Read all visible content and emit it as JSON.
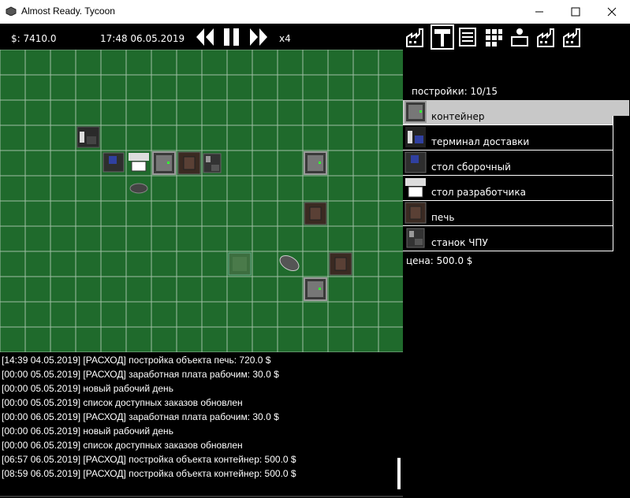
{
  "window": {
    "title": "Almost Ready. Tycoon"
  },
  "topbar": {
    "money": "$: 7410.0",
    "datetime": "17:48 06.05.2019",
    "speed": "x4"
  },
  "toolbar": {
    "icons": [
      "factory-icon",
      "hammer-icon",
      "orders-icon",
      "grid-icon",
      "worker-icon",
      "factory-icon",
      "factory-icon"
    ]
  },
  "side": {
    "buildings_count": "постройки: 10/15",
    "items": [
      {
        "label": "контейнер",
        "icon": "container-icon"
      },
      {
        "label": "терминал доставки",
        "icon": "terminal-icon"
      },
      {
        "label": "стол сборочный",
        "icon": "assembly-table-icon"
      },
      {
        "label": "стол разработчика",
        "icon": "developer-desk-icon"
      },
      {
        "label": "печь",
        "icon": "furnace-icon"
      },
      {
        "label": "станок ЧПУ",
        "icon": "cnc-machine-icon"
      }
    ],
    "price": "цена: 500.0 $"
  },
  "log": [
    "[14:39 04.05.2019] [РАСХОД] постройка объекта печь: 720.0 $",
    "[00:00 05.05.2019] [РАСХОД] заработная плата рабочим: 30.0 $",
    "[00:00 05.05.2019] новый рабочий день",
    "[00:00 05.05.2019] список доступных заказов обновлен",
    "[00:00 06.05.2019] [РАСХОД] заработная плата рабочим: 30.0 $",
    "[00:00 06.05.2019] новый рабочий день",
    "[00:00 06.05.2019] список доступных заказов обновлен",
    "[06:57 06.05.2019] [РАСХОД] постройка объекта контейнер: 500.0 $",
    "[08:59 06.05.2019] [РАСХОД] постройка объекта контейнер: 500.0 $"
  ],
  "colors": {
    "grass": "#1f6a2c",
    "grid_line": "#9fbfa4",
    "selected_item": "#c8c8c8"
  }
}
